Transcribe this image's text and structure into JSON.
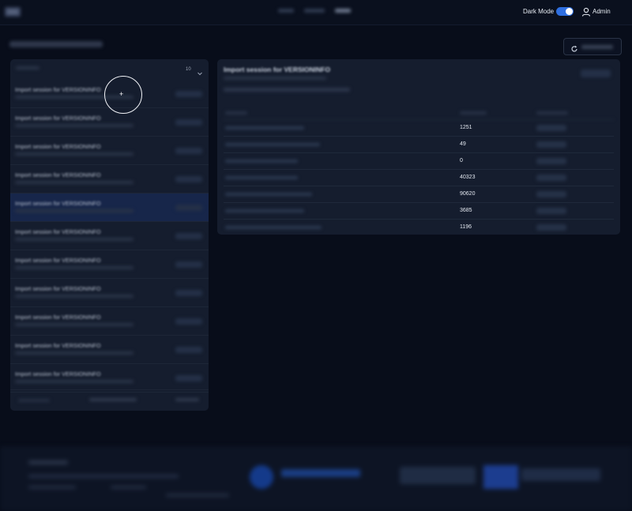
{
  "header": {
    "dark_mode_label": "Dark Mode",
    "user_label": "Admin"
  },
  "sessions": [
    {
      "title": "Import session for VERSIONINFO"
    },
    {
      "title": "Import session for VERSIONINFO"
    },
    {
      "title": "Import session for VERSIONINFO"
    },
    {
      "title": "Import session for VERSIONINFO"
    },
    {
      "title": "Import session for VERSIONINFO",
      "selected": true
    },
    {
      "title": "Import session for VERSIONINFO"
    },
    {
      "title": "Import session for VERSIONINFO"
    },
    {
      "title": "Import session for VERSIONINFO"
    },
    {
      "title": "Import session for VERSIONINFO"
    },
    {
      "title": "Import session for VERSIONINFO"
    },
    {
      "title": "Import session for VERSIONINFO"
    }
  ],
  "list": {
    "page_size": "10"
  },
  "detail": {
    "title": "Import session for VERSIONINFO",
    "rows": [
      {
        "count": "1251"
      },
      {
        "count": "49"
      },
      {
        "count": "0"
      },
      {
        "count": "40323"
      },
      {
        "count": "90620"
      },
      {
        "count": "3685"
      },
      {
        "count": "1196"
      }
    ]
  },
  "colors": {
    "accent": "#2f6fe0",
    "background": "#080d1a",
    "panel": "#151d2e",
    "selected_row": "#17264a"
  },
  "icons": {
    "refresh": "refresh-icon",
    "user": "user-icon",
    "chevron": "chevron-down-icon"
  }
}
